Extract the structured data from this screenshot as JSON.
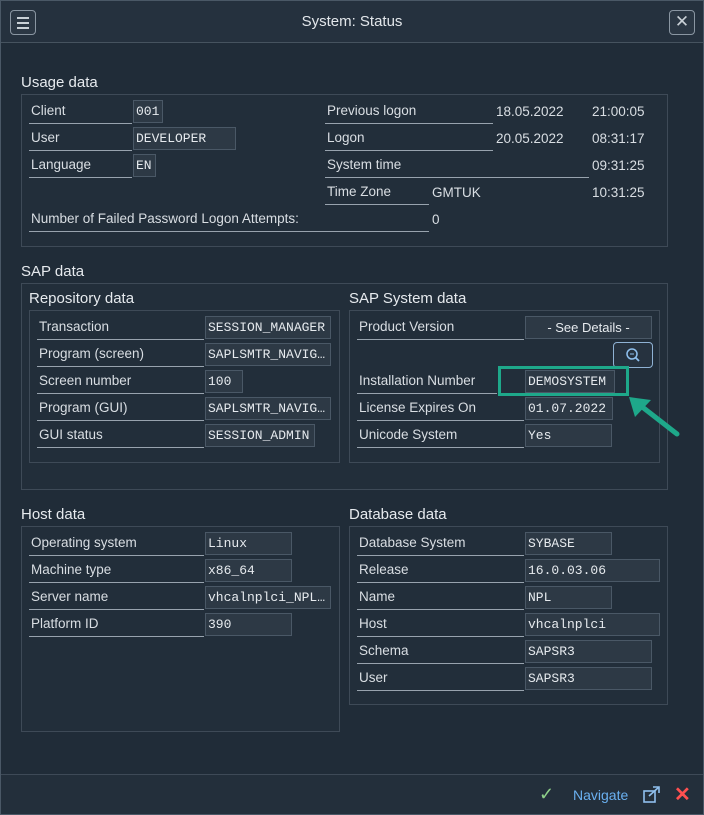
{
  "window": {
    "title": "System: Status"
  },
  "usage": {
    "title": "Usage data",
    "client_label": "Client",
    "client_value": "001",
    "user_label": "User",
    "user_value": "DEVELOPER",
    "language_label": "Language",
    "language_value": "EN",
    "prev_logon_label": "Previous logon",
    "prev_logon_date": "18.05.2022",
    "prev_logon_time": "21:00:05",
    "logon_label": "Logon",
    "logon_date": "20.05.2022",
    "logon_time": "08:31:17",
    "system_time_label": "System time",
    "system_time": "09:31:25",
    "timezone_label": "Time Zone",
    "timezone_value": "GMTUK",
    "timezone_time": "10:31:25",
    "failed_label": "Number of Failed Password Logon Attempts:",
    "failed_value": "0"
  },
  "sap": {
    "title": "SAP data",
    "repo_title": "Repository data",
    "transaction_label": "Transaction",
    "transaction_value": "SESSION_MANAGER",
    "program_screen_label": "Program (screen)",
    "program_screen_value": "SAPLSMTR_NAVIG…",
    "screen_number_label": "Screen number",
    "screen_number_value": "100",
    "program_gui_label": "Program (GUI)",
    "program_gui_value": "SAPLSMTR_NAVIG…",
    "gui_status_label": "GUI status",
    "gui_status_value": "SESSION_ADMIN",
    "system_title": "SAP System data",
    "product_version_label": "Product Version",
    "product_version_value": "- See Details -",
    "installation_label": "Installation Number",
    "installation_value": "DEMOSYSTEM",
    "license_label": "License Expires On",
    "license_value": "01.07.2022",
    "unicode_label": "Unicode System",
    "unicode_value": "Yes"
  },
  "host": {
    "title": "Host data",
    "os_label": "Operating system",
    "os_value": "Linux",
    "machine_label": "Machine type",
    "machine_value": "x86_64",
    "server_label": "Server name",
    "server_value": "vhcalnplci_NPL…",
    "platform_label": "Platform ID",
    "platform_value": "390"
  },
  "database": {
    "title": "Database data",
    "system_label": "Database System",
    "system_value": "SYBASE",
    "release_label": "Release",
    "release_value": "16.0.03.06",
    "name_label": "Name",
    "name_value": "NPL",
    "host_label": "Host",
    "host_value": "vhcalnplci",
    "schema_label": "Schema",
    "schema_value": "SAPSR3",
    "user_label": "User",
    "user_value": "SAPSR3"
  },
  "footer": {
    "navigate_label": "Navigate"
  },
  "colors": {
    "highlight": "#1ea88a",
    "link": "#6ab0f0",
    "cancel": "#ff5050",
    "confirm": "#8fd18a"
  }
}
